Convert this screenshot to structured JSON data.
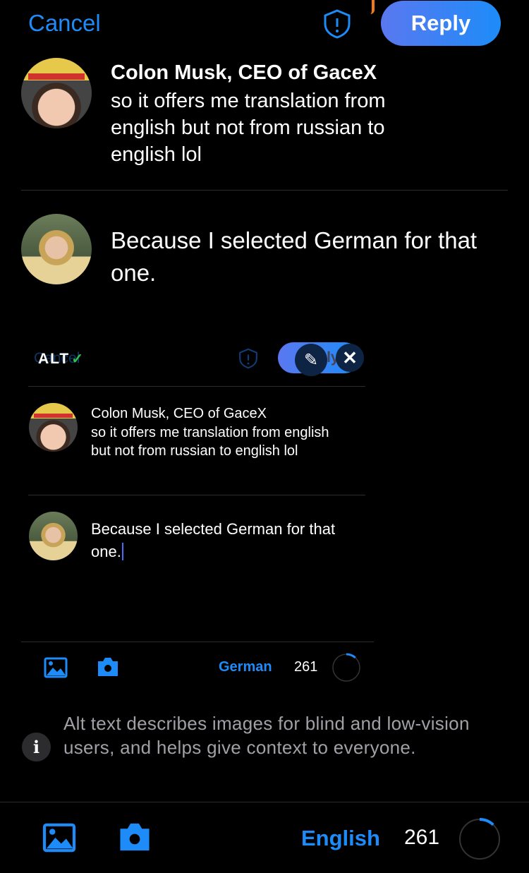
{
  "header": {
    "cancel_label": "Cancel",
    "reply_label": "Reply",
    "shield_icon": "shield-exclamation-icon"
  },
  "thread": [
    {
      "author": "Colon Musk, CEO of GaceX",
      "text": "so it offers me translation from english but not from russian to english lol"
    },
    {
      "text": "Because I selected German for that one."
    }
  ],
  "attachment": {
    "alt_badge": "ALT",
    "faded_cancel": "Cancel",
    "faded_reply": "Reply",
    "thread": [
      {
        "author": "Colon Musk, CEO of GaceX",
        "text": "so it offers me translation from english but not from russian to english lol"
      },
      {
        "text": "Because I selected German for that one."
      }
    ],
    "language": "German",
    "char_count": "261"
  },
  "info": {
    "text": "Alt text describes images for blind and low-vision users, and helps give context to everyone."
  },
  "toolbar": {
    "language": "English",
    "char_count": "261",
    "progress_fraction": 0.12
  },
  "colors": {
    "accent": "#1d8cf8",
    "reply_gradient_start": "#5a78f0",
    "reply_gradient_end": "#1d8cf8"
  }
}
